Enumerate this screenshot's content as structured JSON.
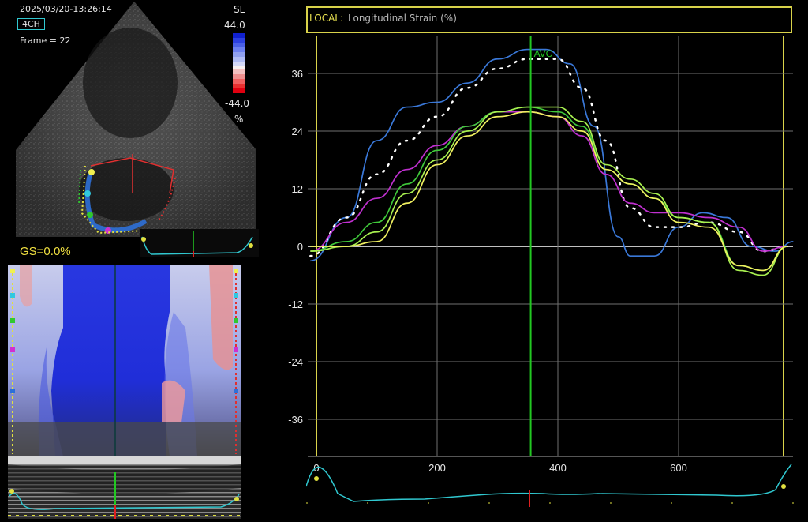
{
  "echo": {
    "timestamp": "2025/03/20-13:26:14",
    "view": "4CH",
    "frame": "Frame = 22",
    "scale_title": "SL",
    "scale_max": "44.0",
    "scale_min": "-44.0",
    "scale_unit": "%",
    "gs": "GS=0.0%"
  },
  "colors": {
    "frame_yellow": "#d8d24a",
    "curve_blue": "#3a78d8",
    "curve_white": "#ffffff",
    "curve_magenta": "#c030d0",
    "curve_green": "#3fc83a",
    "curve_lime": "#a8f050",
    "curve_yellow": "#f0f060",
    "ecg": "#30c8d0",
    "avc": "#22c822"
  },
  "chart_data": {
    "type": "line",
    "title_prefix": "LOCAL:",
    "title": "Longitudinal Strain (%)",
    "xlabel": "",
    "ylabel": "",
    "x_ticks": [
      "0",
      "200",
      "400",
      "600"
    ],
    "y_ticks": [
      "36",
      "24",
      "12",
      "0",
      "-12",
      "-24",
      "-36"
    ],
    "xlim": [
      -15,
      795
    ],
    "ylim": [
      -44,
      44
    ],
    "grid": true,
    "marker": {
      "label": "AVC",
      "x": 355
    },
    "series": [
      {
        "color": "#3a78d8",
        "style": "solid",
        "x": [
          -10,
          50,
          100,
          150,
          200,
          250,
          300,
          350,
          380,
          420,
          460,
          500,
          520,
          560,
          600,
          640,
          680,
          720,
          760,
          790
        ],
        "y": [
          -3,
          6,
          22,
          29,
          30,
          34,
          39,
          41,
          41,
          38,
          25,
          2,
          -2,
          -2,
          4,
          7,
          6,
          0,
          -1,
          1
        ]
      },
      {
        "color": "#ffffff",
        "style": "dotted",
        "x": [
          -10,
          50,
          100,
          150,
          200,
          250,
          300,
          350,
          400,
          440,
          480,
          520,
          560,
          600,
          650,
          700,
          740,
          780
        ],
        "y": [
          -2,
          6,
          15,
          22,
          27,
          33,
          37,
          39,
          39,
          33,
          22,
          8,
          4,
          4,
          5,
          3,
          -1,
          0
        ]
      },
      {
        "color": "#c030d0",
        "style": "solid",
        "x": [
          -10,
          50,
          100,
          150,
          200,
          250,
          300,
          350,
          400,
          440,
          480,
          520,
          560,
          600,
          650,
          700,
          740,
          780
        ],
        "y": [
          -1,
          5,
          10,
          16,
          21,
          25,
          28,
          28,
          27,
          23,
          15,
          9,
          7,
          7,
          6,
          4,
          -1,
          0
        ]
      },
      {
        "color": "#3fc83a",
        "style": "solid",
        "x": [
          -10,
          50,
          100,
          150,
          200,
          250,
          300,
          350,
          400,
          440,
          480,
          520,
          560,
          600,
          650,
          700,
          740,
          780
        ],
        "y": [
          -1,
          1,
          5,
          13,
          20,
          25,
          28,
          29,
          28,
          25,
          16,
          13,
          10,
          6,
          5,
          -4,
          -5,
          0
        ]
      },
      {
        "color": "#a8f050",
        "style": "solid",
        "x": [
          -10,
          50,
          100,
          150,
          200,
          250,
          300,
          350,
          400,
          440,
          480,
          520,
          560,
          600,
          650,
          700,
          740,
          780
        ],
        "y": [
          -1,
          0,
          3,
          11,
          18,
          24,
          28,
          29,
          29,
          26,
          17,
          14,
          11,
          6,
          5,
          -5,
          -6,
          0
        ]
      },
      {
        "color": "#f0f060",
        "style": "solid",
        "x": [
          -10,
          50,
          100,
          150,
          200,
          250,
          300,
          350,
          400,
          440,
          480,
          520,
          560,
          600,
          650,
          700,
          740,
          780
        ],
        "y": [
          0,
          0,
          1,
          9,
          17,
          23,
          27,
          28,
          27,
          24,
          16,
          13,
          10,
          5,
          4,
          -4,
          -5,
          0
        ]
      }
    ]
  }
}
